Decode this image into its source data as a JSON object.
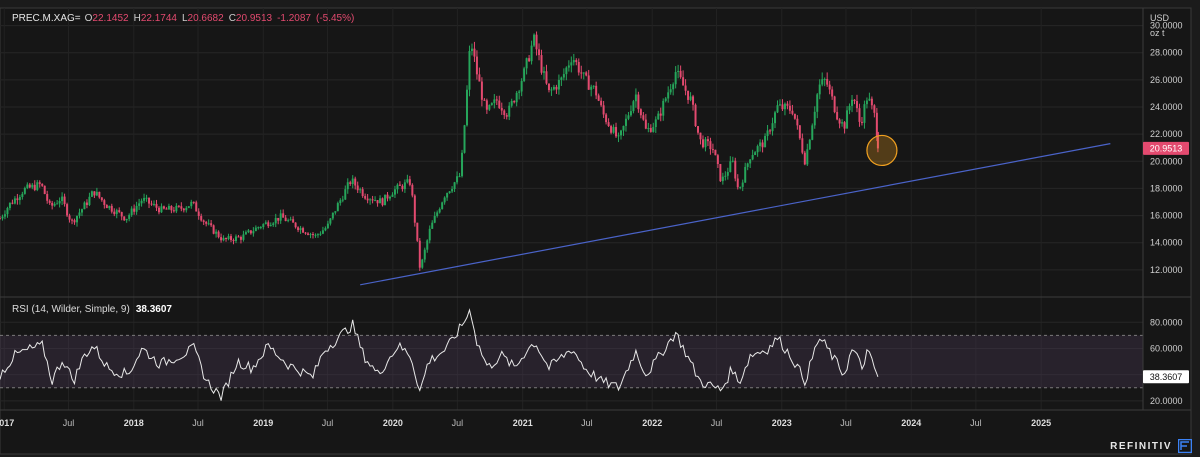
{
  "header": {
    "symbol": "PREC.M.XAG=",
    "open_label": "O",
    "open": "22.1452",
    "high_label": "H",
    "high": "22.1744",
    "low_label": "L",
    "low": "20.6682",
    "close_label": "C",
    "close": "20.9513",
    "change": "-1.2087",
    "change_pct": "(-5.45%)"
  },
  "unit": {
    "line1": "USD",
    "line2": "oz t"
  },
  "last_price_label": "20.9513",
  "rsi": {
    "label": "RSI (14, Wilder, Simple, 9)",
    "value": "38.3607"
  },
  "brand": "REFINITIV",
  "colors": {
    "up": "#26a65b",
    "down": "#e34a6f",
    "trendline": "#4a63c9",
    "highlight": "#f0a020",
    "rsi_line": "#e8e8e8",
    "rsi_band": "#4a3a55"
  },
  "chart_data": [
    {
      "type": "candlestick",
      "ylim": [
        10,
        31
      ],
      "yticks": [
        "12.0000",
        "14.0000",
        "16.0000",
        "18.0000",
        "20.0000",
        "22.0000",
        "24.0000",
        "26.0000",
        "28.0000",
        "30.0000"
      ],
      "ytick_values": [
        12,
        14,
        16,
        18,
        20,
        22,
        24,
        26,
        28,
        30
      ],
      "x_range": [
        "2016-12-20",
        "2025-10-15"
      ],
      "x_ticks": [
        {
          "label": "2017",
          "date": "2017-01-01",
          "bold": true
        },
        {
          "label": "Jul",
          "date": "2017-07-01",
          "bold": false
        },
        {
          "label": "2018",
          "date": "2018-01-01",
          "bold": true
        },
        {
          "label": "Jul",
          "date": "2018-07-01",
          "bold": false
        },
        {
          "label": "2019",
          "date": "2019-01-01",
          "bold": true
        },
        {
          "label": "Jul",
          "date": "2019-07-01",
          "bold": false
        },
        {
          "label": "2020",
          "date": "2020-01-01",
          "bold": true
        },
        {
          "label": "Jul",
          "date": "2020-07-01",
          "bold": false
        },
        {
          "label": "2021",
          "date": "2021-01-01",
          "bold": true
        },
        {
          "label": "Jul",
          "date": "2021-07-01",
          "bold": false
        },
        {
          "label": "2022",
          "date": "2022-01-01",
          "bold": true
        },
        {
          "label": "Jul",
          "date": "2022-07-01",
          "bold": false
        },
        {
          "label": "2023",
          "date": "2023-01-01",
          "bold": true
        },
        {
          "label": "Jul",
          "date": "2023-07-01",
          "bold": false
        },
        {
          "label": "2024",
          "date": "2024-01-01",
          "bold": true
        },
        {
          "label": "Jul",
          "date": "2024-07-01",
          "bold": false
        },
        {
          "label": "2025",
          "date": "2025-01-01",
          "bold": true
        }
      ],
      "close_series": [
        [
          "2016-12-20",
          15.8
        ],
        [
          "2017-01-15",
          16.8
        ],
        [
          "2017-02-25",
          17.9
        ],
        [
          "2017-04-15",
          18.3
        ],
        [
          "2017-05-10",
          16.6
        ],
        [
          "2017-06-10",
          17.3
        ],
        [
          "2017-07-10",
          15.5
        ],
        [
          "2017-08-20",
          16.9
        ],
        [
          "2017-09-10",
          17.8
        ],
        [
          "2017-10-15",
          16.8
        ],
        [
          "2017-12-10",
          15.8
        ],
        [
          "2018-01-25",
          17.2
        ],
        [
          "2018-03-20",
          16.4
        ],
        [
          "2018-05-10",
          16.5
        ],
        [
          "2018-06-15",
          16.9
        ],
        [
          "2018-07-20",
          15.5
        ],
        [
          "2018-09-10",
          14.2
        ],
        [
          "2018-11-01",
          14.4
        ],
        [
          "2018-12-20",
          15.2
        ],
        [
          "2019-02-20",
          15.9
        ],
        [
          "2019-04-20",
          15.0
        ],
        [
          "2019-05-28",
          14.5
        ],
        [
          "2019-07-01",
          15.2
        ],
        [
          "2019-07-20",
          16.3
        ],
        [
          "2019-09-05",
          18.6
        ],
        [
          "2019-10-15",
          17.5
        ],
        [
          "2019-12-01",
          17.0
        ],
        [
          "2019-12-31",
          17.8
        ],
        [
          "2020-02-20",
          18.5
        ],
        [
          "2020-03-18",
          12.0
        ],
        [
          "2020-04-15",
          15.0
        ],
        [
          "2020-05-25",
          17.5
        ],
        [
          "2020-07-10",
          19.0
        ],
        [
          "2020-07-25",
          24.0
        ],
        [
          "2020-08-07",
          29.0
        ],
        [
          "2020-08-25",
          26.5
        ],
        [
          "2020-09-20",
          23.5
        ],
        [
          "2020-10-20",
          24.5
        ],
        [
          "2020-11-20",
          23.5
        ],
        [
          "2021-01-05",
          26.5
        ],
        [
          "2021-02-01",
          29.0
        ],
        [
          "2021-03-15",
          25.0
        ],
        [
          "2021-04-20",
          26.0
        ],
        [
          "2021-05-20",
          27.8
        ],
        [
          "2021-06-25",
          26.0
        ],
        [
          "2021-07-25",
          25.2
        ],
        [
          "2021-08-15",
          23.5
        ],
        [
          "2021-09-29",
          21.5
        ],
        [
          "2021-11-15",
          25.0
        ],
        [
          "2021-12-15",
          22.2
        ],
        [
          "2022-01-15",
          23.0
        ],
        [
          "2022-03-08",
          26.6
        ],
        [
          "2022-04-20",
          24.5
        ],
        [
          "2022-05-15",
          21.5
        ],
        [
          "2022-06-20",
          21.0
        ],
        [
          "2022-07-15",
          18.5
        ],
        [
          "2022-08-15",
          20.0
        ],
        [
          "2022-09-01",
          17.8
        ],
        [
          "2022-10-05",
          20.5
        ],
        [
          "2022-11-15",
          21.5
        ],
        [
          "2022-12-20",
          24.0
        ],
        [
          "2023-02-01",
          23.8
        ],
        [
          "2023-03-08",
          20.0
        ],
        [
          "2023-04-15",
          25.5
        ],
        [
          "2023-05-05",
          26.0
        ],
        [
          "2023-06-05",
          23.5
        ],
        [
          "2023-06-25",
          22.5
        ],
        [
          "2023-07-20",
          25.0
        ],
        [
          "2023-08-10",
          22.7
        ],
        [
          "2023-08-30",
          24.8
        ],
        [
          "2023-09-20",
          23.3
        ],
        [
          "2023-09-26",
          22.2
        ],
        [
          "2023-09-29",
          20.95
        ]
      ]
    },
    {
      "type": "line",
      "series": [
        {
          "name": "RSI (14, Wilder, Simple, 9)",
          "last": 38.3607
        }
      ],
      "ylim": [
        13,
        97
      ],
      "yticks": [
        "20.0000",
        "40.0000",
        "60.0000",
        "80.0000"
      ],
      "ytick_values": [
        20,
        40,
        60,
        80
      ],
      "bands": [
        30,
        70
      ],
      "rsi_series": [
        [
          "2016-12-20",
          40
        ],
        [
          "2017-02-01",
          55
        ],
        [
          "2017-03-20",
          60
        ],
        [
          "2017-04-20",
          62
        ],
        [
          "2017-05-15",
          35
        ],
        [
          "2017-06-15",
          52
        ],
        [
          "2017-07-15",
          35
        ],
        [
          "2017-08-15",
          55
        ],
        [
          "2017-09-10",
          62
        ],
        [
          "2017-10-20",
          45
        ],
        [
          "2017-12-15",
          40
        ],
        [
          "2018-01-25",
          60
        ],
        [
          "2018-03-15",
          48
        ],
        [
          "2018-05-15",
          55
        ],
        [
          "2018-06-20",
          60
        ],
        [
          "2018-07-25",
          35
        ],
        [
          "2018-09-05",
          23
        ],
        [
          "2018-10-20",
          50
        ],
        [
          "2018-12-01",
          45
        ],
        [
          "2019-01-15",
          62
        ],
        [
          "2019-03-10",
          48
        ],
        [
          "2019-05-20",
          38
        ],
        [
          "2019-06-20",
          58
        ],
        [
          "2019-08-15",
          72
        ],
        [
          "2019-09-10",
          78
        ],
        [
          "2019-10-10",
          55
        ],
        [
          "2019-11-20",
          40
        ],
        [
          "2020-01-15",
          62
        ],
        [
          "2020-02-20",
          55
        ],
        [
          "2020-03-18",
          27
        ],
        [
          "2020-04-10",
          50
        ],
        [
          "2020-06-01",
          60
        ],
        [
          "2020-07-15",
          78
        ],
        [
          "2020-08-07",
          90
        ],
        [
          "2020-08-25",
          65
        ],
        [
          "2020-09-25",
          45
        ],
        [
          "2020-11-01",
          55
        ],
        [
          "2020-12-10",
          45
        ],
        [
          "2021-01-10",
          58
        ],
        [
          "2021-02-05",
          65
        ],
        [
          "2021-03-15",
          45
        ],
        [
          "2021-05-20",
          60
        ],
        [
          "2021-06-25",
          45
        ],
        [
          "2021-08-10",
          35
        ],
        [
          "2021-09-29",
          30
        ],
        [
          "2021-11-15",
          58
        ],
        [
          "2021-12-15",
          40
        ],
        [
          "2022-03-08",
          72
        ],
        [
          "2022-05-15",
          35
        ],
        [
          "2022-07-15",
          28
        ],
        [
          "2022-08-15",
          45
        ],
        [
          "2022-09-01",
          33
        ],
        [
          "2022-10-05",
          55
        ],
        [
          "2022-11-25",
          60
        ],
        [
          "2022-12-20",
          68
        ],
        [
          "2023-02-01",
          52
        ],
        [
          "2023-03-08",
          35
        ],
        [
          "2023-04-15",
          68
        ],
        [
          "2023-05-05",
          62
        ],
        [
          "2023-06-25",
          40
        ],
        [
          "2023-07-20",
          60
        ],
        [
          "2023-08-15",
          45
        ],
        [
          "2023-08-30",
          58
        ],
        [
          "2023-09-29",
          38.36
        ]
      ]
    }
  ],
  "trendline": {
    "x1": "2019-10-01",
    "y1": 10.9,
    "x2": "2025-07-15",
    "y2": 21.3
  },
  "highlight_circle": {
    "date": "2023-09-29",
    "price": 20.8
  }
}
